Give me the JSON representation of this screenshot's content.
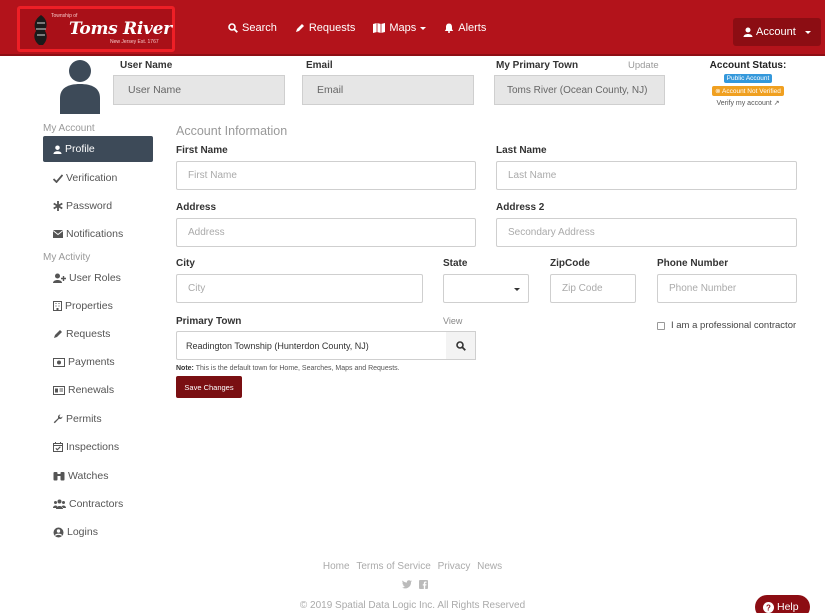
{
  "brand": {
    "small_text": "Township of",
    "title": "Toms River",
    "tagline": "New Jersey Est. 1767"
  },
  "nav": {
    "search": "Search",
    "requests": "Requests",
    "maps": "Maps",
    "alerts": "Alerts",
    "account": "Account"
  },
  "profile_header": {
    "user_name_label": "User Name",
    "user_name_value": "User Name",
    "email_label": "Email",
    "email_value": "Email",
    "primary_town_label": "My Primary Town",
    "update_link": "Update",
    "primary_town_value": "Toms River (Ocean County, NJ)",
    "account_status_label": "Account Status:",
    "badge_public": "Public Account",
    "badge_not_verified": "Account Not Verified",
    "verify_text": "Verify my account"
  },
  "sidebar": {
    "group_account": "My Account",
    "group_activity": "My Activity",
    "items": [
      {
        "label": "Profile",
        "icon": "user-icon"
      },
      {
        "label": "Verification",
        "icon": "check-icon"
      },
      {
        "label": "Password",
        "icon": "asterisk-icon"
      },
      {
        "label": "Notifications",
        "icon": "envelope-icon"
      },
      {
        "label": "User Roles",
        "icon": "user-plus-icon"
      },
      {
        "label": "Properties",
        "icon": "building-icon"
      },
      {
        "label": "Requests",
        "icon": "pencil-icon"
      },
      {
        "label": "Payments",
        "icon": "money-icon"
      },
      {
        "label": "Renewals",
        "icon": "id-card-icon"
      },
      {
        "label": "Permits",
        "icon": "wrench-icon"
      },
      {
        "label": "Inspections",
        "icon": "calendar-check-icon"
      },
      {
        "label": "Watches",
        "icon": "binoculars-icon"
      },
      {
        "label": "Contractors",
        "icon": "users-icon"
      },
      {
        "label": "Logins",
        "icon": "sign-in-icon"
      }
    ]
  },
  "form": {
    "section_title": "Account Information",
    "first_name_label": "First Name",
    "first_name_placeholder": "First Name",
    "last_name_label": "Last Name",
    "last_name_placeholder": "Last Name",
    "address_label": "Address",
    "address_placeholder": "Address",
    "address2_label": "Address 2",
    "address2_placeholder": "Secondary Address",
    "city_label": "City",
    "city_placeholder": "City",
    "state_label": "State",
    "state_value": "",
    "zip_label": "ZipCode",
    "zip_placeholder": "Zip Code",
    "phone_label": "Phone Number",
    "phone_placeholder": "Phone Number",
    "primary_town_label": "Primary Town",
    "view_link": "View",
    "primary_town_value": "Readington Township (Hunterdon County, NJ)",
    "note_label": "Note:",
    "note_text": "This is the default town for Home, Searches, Maps and Requests.",
    "save_button": "Save Changes",
    "contractor_label": "I am a professional contractor"
  },
  "footer": {
    "links": [
      "Home",
      "Terms of Service",
      "Privacy",
      "News"
    ],
    "copyright": "© 2019 Spatial Data Logic Inc. All Rights Reserved",
    "help": "Help"
  },
  "colors": {
    "brand_red": "#b3131b",
    "dark_red": "#8c0d13",
    "save_red": "#7a0f12",
    "sidebar_active": "#3d4a58",
    "badge_blue": "#3498db",
    "badge_orange": "#f0a020"
  }
}
